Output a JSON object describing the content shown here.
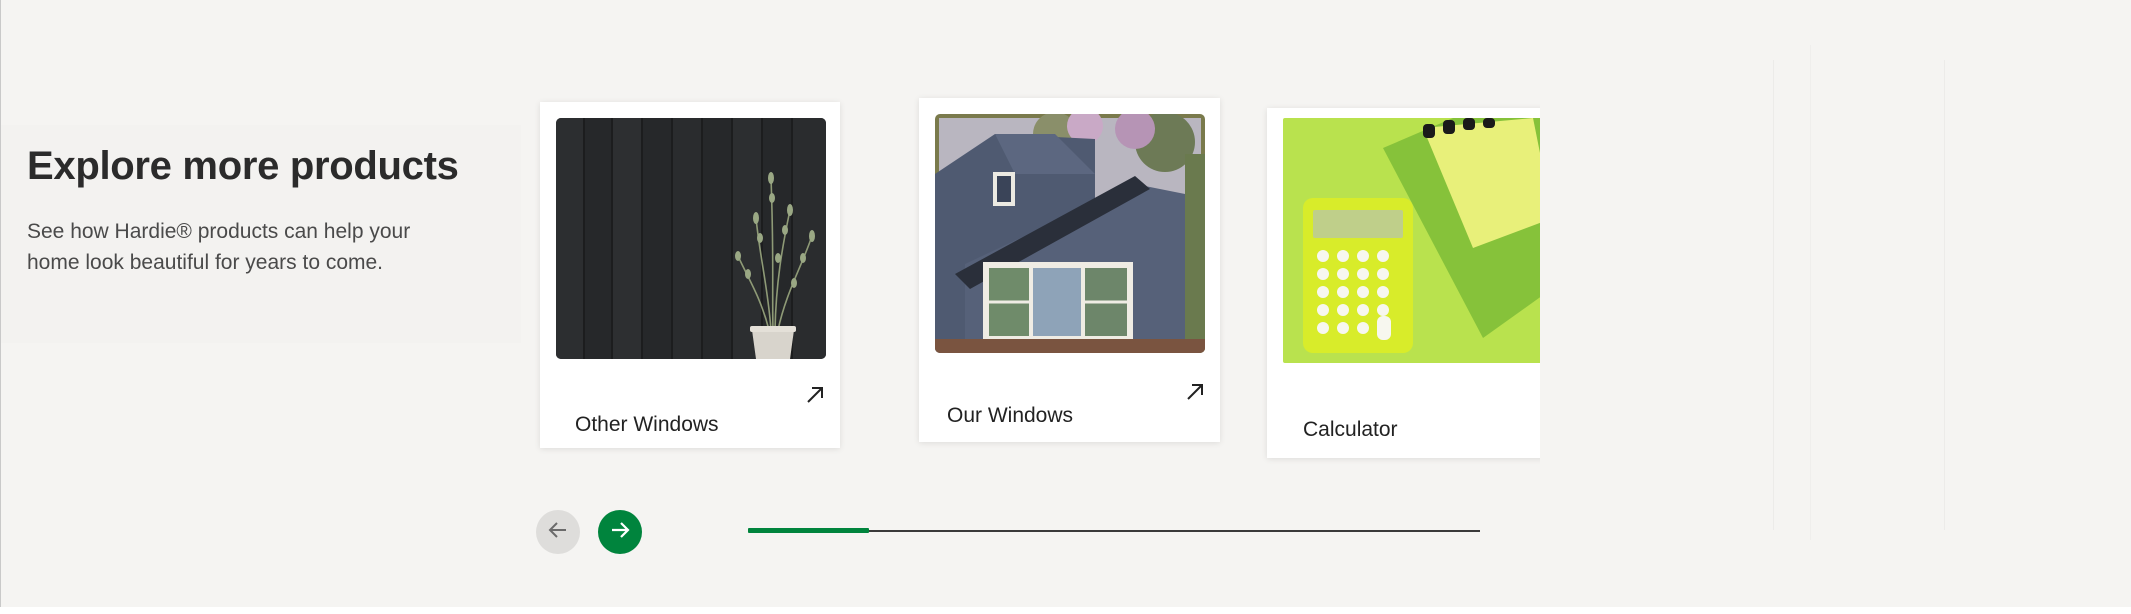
{
  "section": {
    "heading": "Explore more products",
    "description": "See how Hardie® products can help your home look beautiful for years to come."
  },
  "cards": [
    {
      "title": "Other Windows",
      "image": "dark-siding-with-plant",
      "link_icon": "arrow-up-right-icon"
    },
    {
      "title": "Our Windows",
      "image": "blue-house-window",
      "link_icon": "arrow-up-right-icon"
    },
    {
      "title": "Calculator",
      "image": "green-calculator-notebook",
      "link_icon": "arrow-up-right-icon"
    }
  ],
  "navigation": {
    "prev_icon": "arrow-left-icon",
    "next_icon": "arrow-right-icon",
    "progress_fraction": 0.165
  },
  "colors": {
    "accent": "#00843d",
    "background": "#f5f4f2",
    "card": "#ffffff",
    "heading": "#2b2b2b"
  }
}
